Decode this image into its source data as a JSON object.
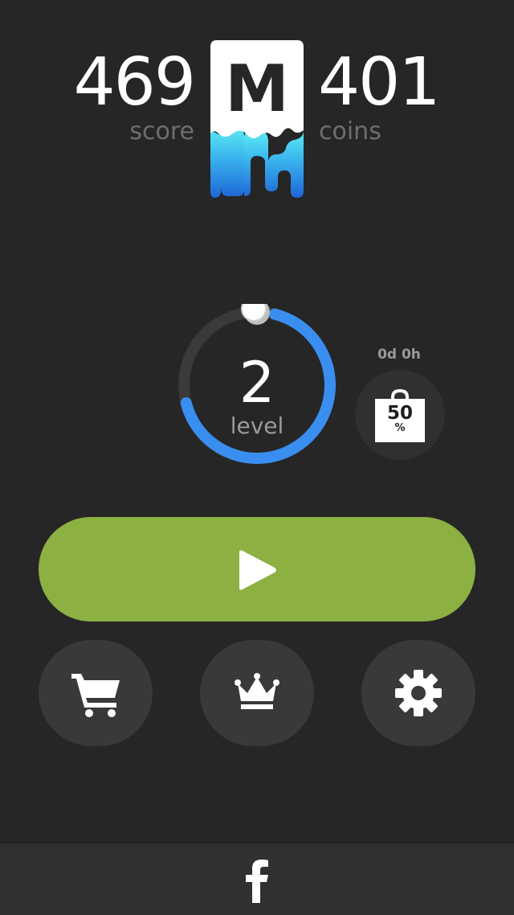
{
  "header": {
    "score_value": "469",
    "score_label": "score",
    "coins_value": "401",
    "coins_label": "coins",
    "logo_letter": "M"
  },
  "level": {
    "number": "2",
    "label": "level",
    "progress": 0.7
  },
  "sale": {
    "timer": "0d 0h",
    "percent": "50",
    "percent_sign": "%"
  },
  "buttons": {
    "play_icon": "play-icon",
    "shop_icon": "shopping-cart-icon",
    "leaderboard_icon": "crown-icon",
    "settings_icon": "gear-icon"
  },
  "footer": {
    "facebook_icon": "facebook-icon"
  },
  "colors": {
    "background": "#262626",
    "play_green": "#8db043",
    "ring_blue": "#3a8ef0",
    "ring_track": "#3c3c3c",
    "logo_blue_top": "#4fe3f0",
    "logo_blue_bottom": "#1f6fd8"
  }
}
